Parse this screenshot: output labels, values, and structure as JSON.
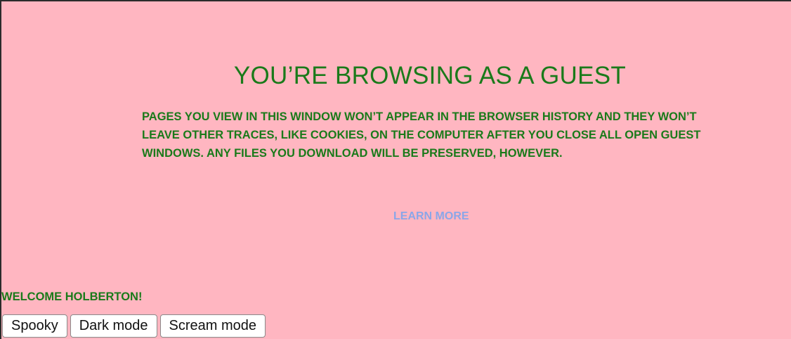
{
  "guest": {
    "title": "YOU’RE BROWSING AS A GUEST",
    "description": "PAGES YOU VIEW IN THIS WINDOW WON’T APPEAR IN THE BROWSER HISTORY AND THEY WON’T LEAVE OTHER TRACES, LIKE COOKIES, ON THE COMPUTER AFTER YOU CLOSE ALL OPEN GUEST WINDOWS. ANY FILES YOU DOWNLOAD WILL BE PRESERVED, HOWEVER.",
    "learn_more": "LEARN MORE"
  },
  "welcome": "WELCOME HOLBERTON!",
  "buttons": {
    "spooky": "Spooky",
    "dark_mode": "Dark mode",
    "scream_mode": "Scream mode"
  },
  "colors": {
    "background": "#ffb6c1",
    "text": "#1a7a1a",
    "link": "#8aa6e8"
  }
}
